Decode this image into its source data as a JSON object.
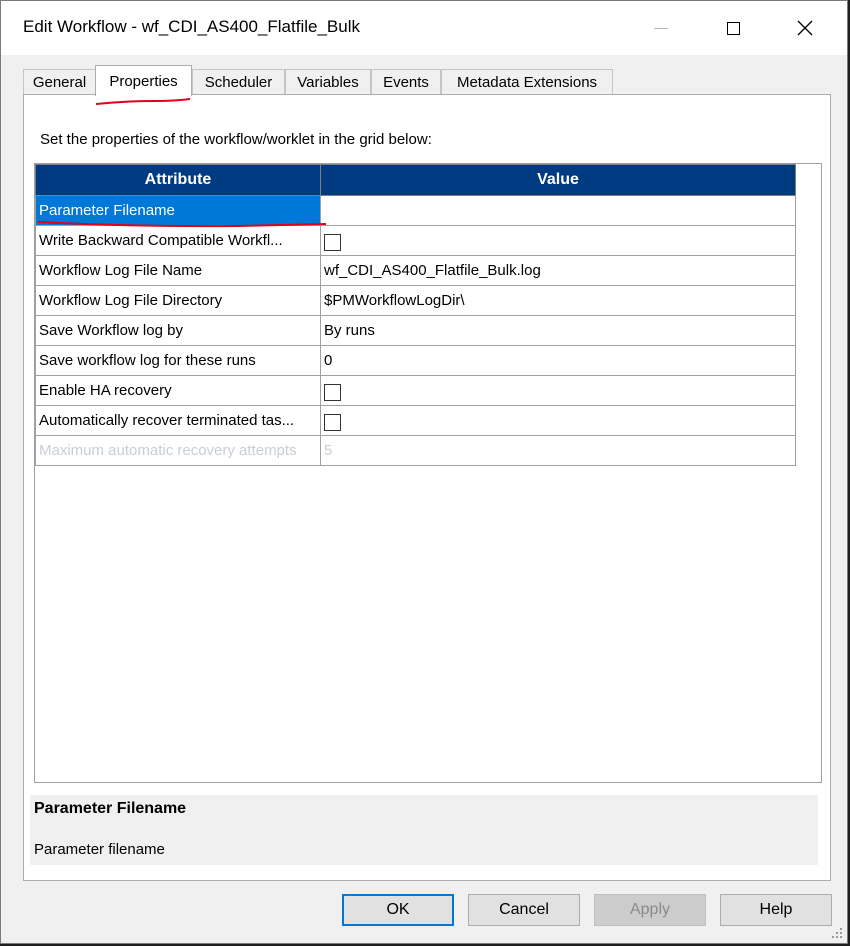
{
  "window": {
    "title": "Edit Workflow - wf_CDI_AS400_Flatfile_Bulk"
  },
  "tabs": [
    {
      "label": "General"
    },
    {
      "label": "Properties",
      "active": true
    },
    {
      "label": "Scheduler"
    },
    {
      "label": "Variables"
    },
    {
      "label": "Events"
    },
    {
      "label": "Metadata Extensions"
    }
  ],
  "properties": {
    "instruction": "Set the properties of the workflow/worklet in the grid below:",
    "columns": {
      "attribute": "Attribute",
      "value": "Value"
    },
    "rows": [
      {
        "attribute": "Parameter Filename",
        "value": "",
        "type": "text",
        "selected": true
      },
      {
        "attribute": "Write Backward Compatible Workfl...",
        "value": "",
        "type": "checkbox",
        "checked": false
      },
      {
        "attribute": "Workflow Log File Name",
        "value": "wf_CDI_AS400_Flatfile_Bulk.log",
        "type": "text"
      },
      {
        "attribute": "Workflow Log File Directory",
        "value": "$PMWorkflowLogDir\\",
        "type": "text"
      },
      {
        "attribute": "Save Workflow log by",
        "value": "By runs",
        "type": "text"
      },
      {
        "attribute": "Save workflow log for these runs",
        "value": "0",
        "type": "text"
      },
      {
        "attribute": "Enable HA recovery",
        "value": "",
        "type": "checkbox",
        "checked": false
      },
      {
        "attribute": "Automatically recover terminated tas...",
        "value": "",
        "type": "checkbox",
        "checked": false
      },
      {
        "attribute": "Maximum automatic recovery attempts",
        "value": "5",
        "type": "text",
        "disabled": true
      }
    ],
    "description": {
      "title": "Parameter Filename",
      "text": "Parameter filename"
    }
  },
  "buttons": {
    "ok": "OK",
    "cancel": "Cancel",
    "apply": "Apply",
    "help": "Help"
  },
  "colors": {
    "header_bg": "#003b82",
    "selection": "#0078d7",
    "annotation": "#e0001a"
  }
}
